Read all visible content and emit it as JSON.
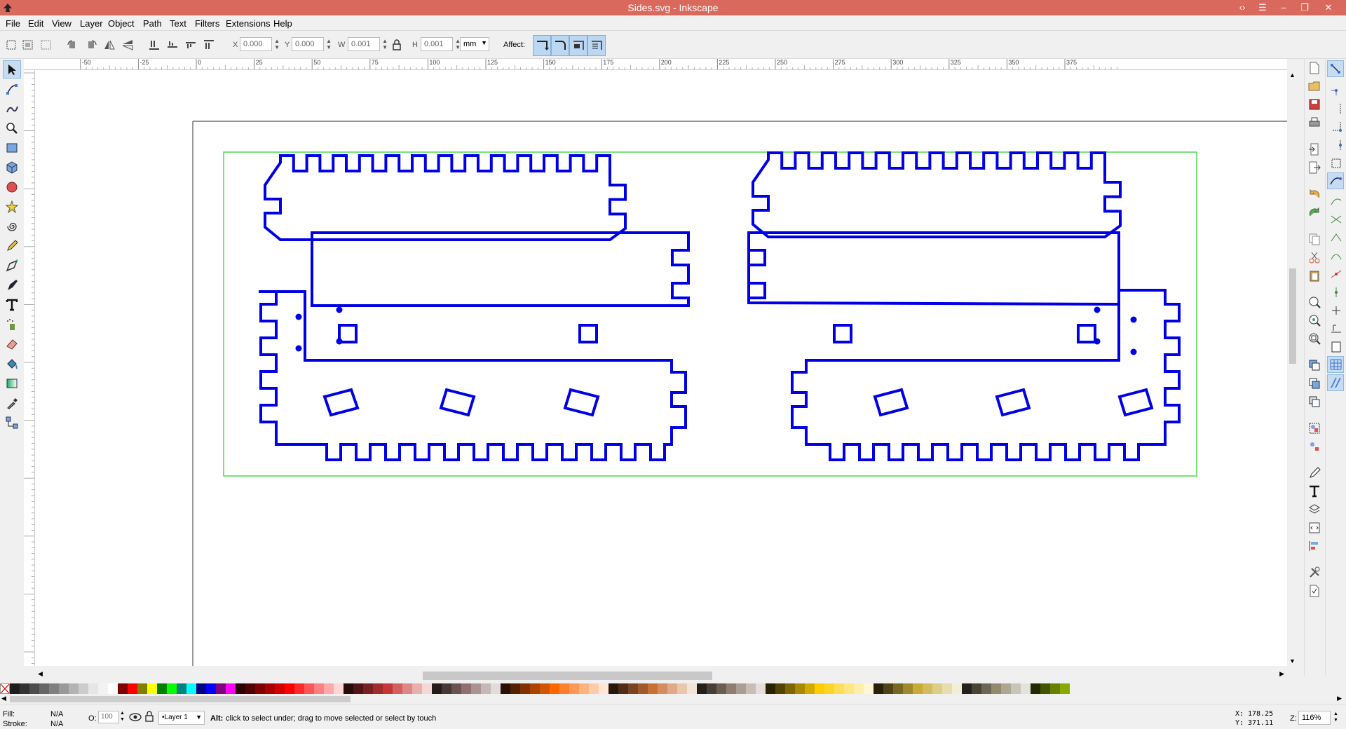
{
  "window": {
    "title": "Sides.svg - Inkscape",
    "controls": [
      "‹›",
      "☰",
      "–",
      "❐",
      "✕"
    ]
  },
  "menu": [
    "File",
    "Edit",
    "View",
    "Layer",
    "Object",
    "Path",
    "Text",
    "Filters",
    "Extensions",
    "Help"
  ],
  "tool_controls": {
    "x_label": "X",
    "x_value": "0.000",
    "y_label": "Y",
    "y_value": "0.000",
    "w_label": "W",
    "w_value": "0.001",
    "h_label": "H",
    "h_value": "0.001",
    "unit": "mm",
    "affect_label": "Affect:"
  },
  "ruler": {
    "h_labels": [
      "-50",
      "-25",
      "0",
      "25",
      "50",
      "75",
      "100",
      "125",
      "150",
      "175",
      "200",
      "225",
      "250",
      "275",
      "300",
      "325",
      "350",
      "375"
    ]
  },
  "tools": [
    "selector-tool-icon",
    "node-tool-icon",
    "tweak-tool-icon",
    "zoom-tool-icon",
    "rectangle-tool-icon",
    "3d-box-tool-icon",
    "ellipse-tool-icon",
    "star-tool-icon",
    "spiral-tool-icon",
    "pencil-tool-icon",
    "pen-tool-icon",
    "calligraphy-tool-icon",
    "text-tool-icon",
    "spray-tool-icon",
    "eraser-tool-icon",
    "paint-bucket-tool-icon",
    "gradient-tool-icon",
    "dropper-tool-icon",
    "connector-tool-icon"
  ],
  "colors": {
    "titlebar": "#d9685d",
    "path_stroke": "#0000e6",
    "selection_bbox": "#4cd94c",
    "active_tool": "#c6dcf2"
  },
  "palette": [
    "#1e1e1e",
    "#333333",
    "#4d4d4d",
    "#666666",
    "#808080",
    "#999999",
    "#b3b3b3",
    "#cccccc",
    "#e6e6e6",
    "#f2f2f2",
    "#ffffff",
    "#800000",
    "#ff0000",
    "#808000",
    "#ffff00",
    "#008000",
    "#00ff00",
    "#008080",
    "#00ffff",
    "#000080",
    "#0000ff",
    "#800080",
    "#ff00ff",
    "#2b0000",
    "#550000",
    "#800000",
    "#aa0000",
    "#d40000",
    "#ff0000",
    "#ff2a2a",
    "#ff5555",
    "#ff8080",
    "#ffaaaa",
    "#ffd5d5",
    "#280b0b",
    "#501616",
    "#782121",
    "#a02c2c",
    "#c83737",
    "#d35f5f",
    "#de8787",
    "#e9afaf",
    "#f4d7d7",
    "#241c1c",
    "#483737",
    "#6c5353",
    "#916f6f",
    "#ac9393",
    "#c8b7b7",
    "#e3dbdb",
    "#2b1100",
    "#552200",
    "#803300",
    "#aa4400",
    "#d45500",
    "#ff6600",
    "#ff7f2a",
    "#ff9955",
    "#ffb380",
    "#ffccaa",
    "#ffe6d5",
    "#28170b",
    "#502d16",
    "#784421",
    "#a05a2c",
    "#c87137",
    "#d38d5f",
    "#deaa87",
    "#e9c6af",
    "#f4e3d7",
    "#241f1c",
    "#483e37",
    "#6c5d53",
    "#917c6f",
    "#ac9d93",
    "#c8beb7",
    "#e3dedb",
    "#2b2200",
    "#554400",
    "#806600",
    "#aa8800",
    "#d4aa00",
    "#ffcc00",
    "#ffd42a",
    "#ffdd55",
    "#ffe680",
    "#ffeeaa",
    "#fff6d5",
    "#28220b",
    "#504416",
    "#786721",
    "#a0892c",
    "#c8ab37",
    "#d3bc5f",
    "#decd87",
    "#e9ddaf",
    "#f4eed7",
    "#24221c",
    "#484537",
    "#6c6753",
    "#918a6f",
    "#aca793",
    "#c8c4b7",
    "#e3e2db",
    "#222b00",
    "#445500",
    "#668000",
    "#88aa00"
  ],
  "status": {
    "fill_label": "Fill:",
    "fill_value": "N/A",
    "stroke_label": "Stroke:",
    "stroke_value": "N/A",
    "opacity_label": "O:",
    "opacity_value": "100",
    "layer": "•Layer 1",
    "message_bold": "Alt:",
    "message": " click to select under; drag to move selected or select by touch",
    "x_label": "X:",
    "x_value": "178.25",
    "y_label": "Y:",
    "y_value": "371.11",
    "zoom_label": "Z:",
    "zoom_value": "116%"
  }
}
